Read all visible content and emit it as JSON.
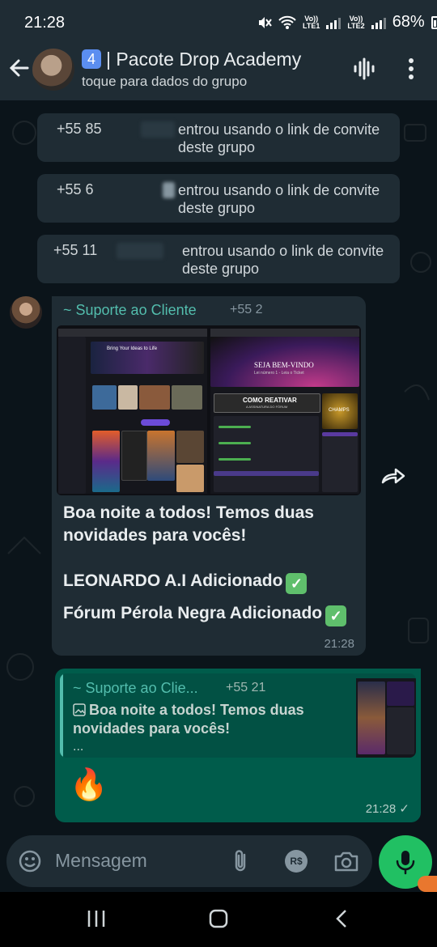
{
  "status": {
    "time": "21:28",
    "lte1": "LTE1",
    "lte2": "LTE2",
    "battery": "68%",
    "vol": "Vo))"
  },
  "header": {
    "badge": "4",
    "title": "| Pacote Drop Academy",
    "subtitle": "toque para dados do grupo"
  },
  "system_messages": [
    {
      "number": "+55 85",
      "text": "entrou usando o link de convite deste grupo"
    },
    {
      "number": "+55 6",
      "text": "entrou usando o link de convite deste grupo"
    },
    {
      "number": "+55 11",
      "text": "entrou usando o link de convite deste grupo"
    }
  ],
  "incoming": {
    "sender": "~ Suporte ao Cliente",
    "sender_number": "+55 2",
    "image_texts": {
      "leonardo_hero": "Bring Your Ideas to Life",
      "welcome": "SEJA BEM-VINDO",
      "welcome_sub": "Lei número 1 - Leia o Ticket",
      "reactivate": "COMO REATIVAR",
      "reactivate_sub": "A ASSINATURA DO FÓRUM",
      "champs": "CHAMPS"
    },
    "line1": "Boa noite a todos! Temos duas novidades para vocês!",
    "line2": "LEONARDO A.I Adicionado",
    "line3": "Fórum Pérola Negra Adicionado",
    "check": "✓",
    "time": "21:28"
  },
  "outgoing": {
    "quote_sender": "~ Suporte ao Clie...",
    "quote_number": "+55 21",
    "quote_text": "Boa noite a todos! Temos duas novidades para vocês!",
    "quote_more": "...",
    "emoji": "🔥",
    "time": "21:28",
    "tick": "✓"
  },
  "composer": {
    "placeholder": "Mensagem",
    "currency": "R$"
  },
  "colors": {
    "background": "#0b141a",
    "bar": "#1f2c34",
    "outgoing": "#005c4b",
    "accent": "#53bdad",
    "mic": "#21c063"
  },
  "icons": [
    "back-arrow-icon",
    "voice-wave-icon",
    "more-vert-icon",
    "forward-icon",
    "emoji-icon",
    "attach-icon",
    "pix-currency-icon",
    "camera-icon",
    "mic-icon",
    "recent-apps-icon",
    "home-icon",
    "nav-back-icon"
  ]
}
